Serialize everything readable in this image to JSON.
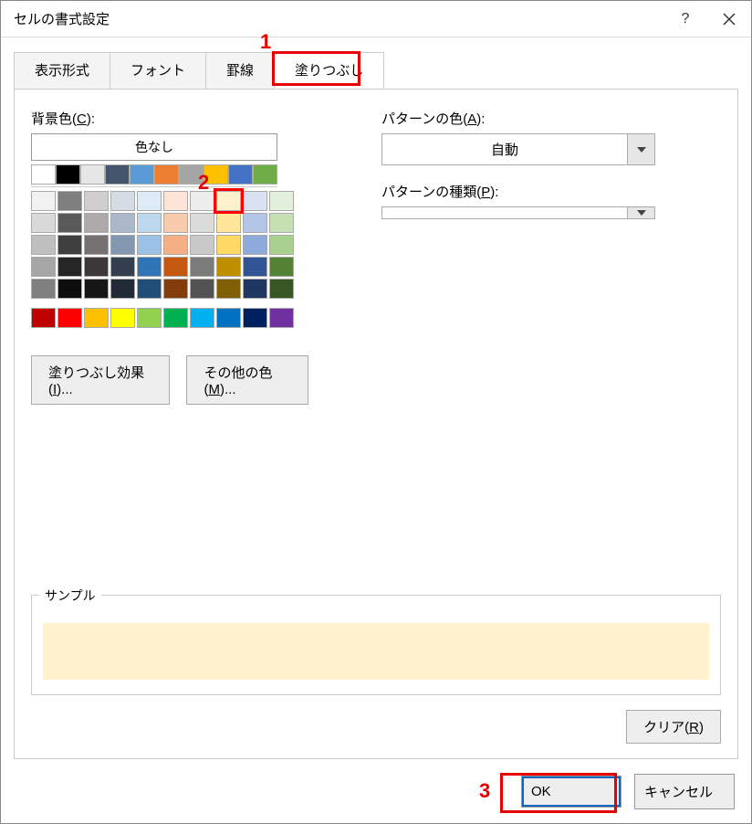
{
  "title": "セルの書式設定",
  "tabs": {
    "format": "表示形式",
    "font": "フォント",
    "border": "罫線",
    "fill": "塗りつぶし"
  },
  "labels": {
    "bgcolor": "背景色(",
    "bgcolor_u": "C",
    "bgcolor_suffix": "):",
    "nocolor": "色なし",
    "fill_effects": "塗りつぶし効果(",
    "fill_effects_u": "I",
    "fill_effects_suffix": ")...",
    "more_colors": "その他の色(",
    "more_colors_u": "M",
    "more_colors_suffix": ")...",
    "pattern_color": "パターンの色(",
    "pattern_color_u": "A",
    "pattern_color_suffix": "):",
    "pattern_type": "パターンの種類(",
    "pattern_type_u": "P",
    "pattern_type_suffix": "):",
    "auto": "自動",
    "sample": "サンプル",
    "clear": "クリア(",
    "clear_u": "R",
    "clear_suffix": ")",
    "ok": "OK",
    "cancel": "キャンセル"
  },
  "annotations": {
    "a1": "1",
    "a2": "2",
    "a3": "3"
  },
  "colors": {
    "themeTopRow": [
      "#FFFFFF",
      "#000000",
      "#E7E6E6",
      "#44546A",
      "#5B9BD5",
      "#ED7D31",
      "#A5A5A5",
      "#FFC000",
      "#4472C4",
      "#70AD47"
    ],
    "themeShades": [
      [
        "#F2F2F2",
        "#7F7F7F",
        "#D0CECE",
        "#D6DCE4",
        "#DDEBF7",
        "#FCE4D6",
        "#EDEDED",
        "#FFF2CC",
        "#D9E1F2",
        "#E2EFDA"
      ],
      [
        "#D9D9D9",
        "#595959",
        "#AEAAAA",
        "#ACB9CA",
        "#BDD7EE",
        "#F8CBAD",
        "#DBDBDB",
        "#FFE699",
        "#B4C6E7",
        "#C6E0B4"
      ],
      [
        "#BFBFBF",
        "#404040",
        "#757171",
        "#8497B0",
        "#9BC2E6",
        "#F4B084",
        "#C9C9C9",
        "#FFD966",
        "#8EA9DB",
        "#A9D08E"
      ],
      [
        "#A6A6A6",
        "#262626",
        "#3A3838",
        "#333F4F",
        "#2F75B5",
        "#C65911",
        "#7B7B7B",
        "#BF8F00",
        "#305496",
        "#548235"
      ],
      [
        "#808080",
        "#0D0D0D",
        "#161616",
        "#222B35",
        "#1F4E78",
        "#833C0C",
        "#525252",
        "#806000",
        "#203764",
        "#375623"
      ]
    ],
    "standard": [
      "#C00000",
      "#FF0000",
      "#FFC000",
      "#FFFF00",
      "#92D050",
      "#00B050",
      "#00B0F0",
      "#0070C0",
      "#002060",
      "#7030A0"
    ],
    "selected": "#FFF2CC",
    "selectedIndex": {
      "row": 0,
      "col": 7
    }
  }
}
